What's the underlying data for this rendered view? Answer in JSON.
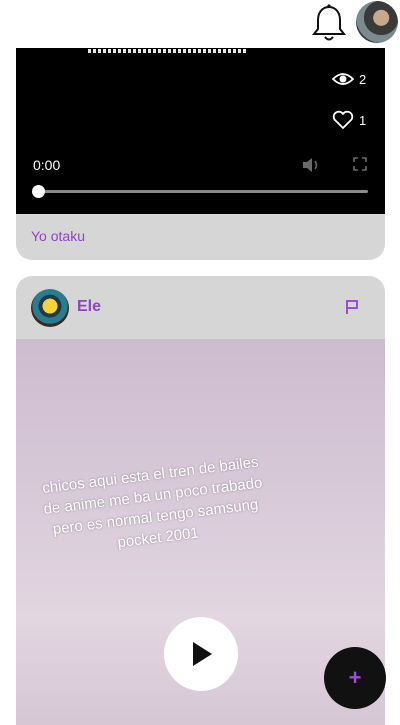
{
  "header": {
    "notifications_icon": "bell-icon",
    "avatar": "user-avatar"
  },
  "post1": {
    "views_icon": "eye-icon",
    "views": "2",
    "likes_icon": "heart-icon",
    "likes": "1",
    "player": {
      "current_time": "0:00",
      "progress": 0,
      "volume_icon": "volume-icon",
      "fullscreen_icon": "fullscreen-icon"
    },
    "caption": "Yo otaku"
  },
  "post2": {
    "author": "Ele",
    "report_icon": "flag-icon",
    "video_overlay_text": "chicos aqui esta el tren de bailes de anime me ba un poco trabado pero es normal tengo samsung pocket 2001",
    "play_icon": "play-icon"
  },
  "fab": {
    "label": "+"
  },
  "colors": {
    "accent": "#8e44c6",
    "card_bg": "#d6d6d6",
    "video_bg": "#000000",
    "fab_bg": "#111111"
  }
}
